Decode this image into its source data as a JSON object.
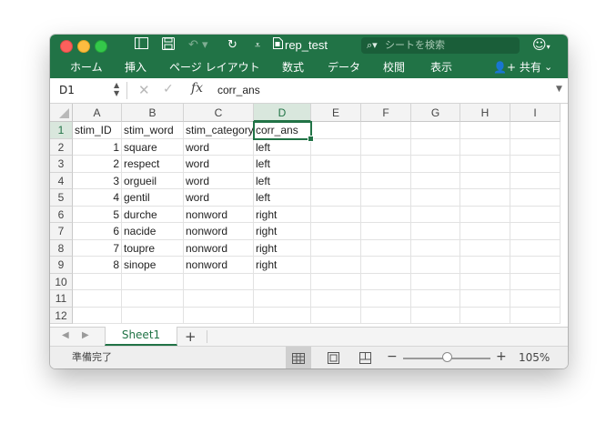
{
  "window": {
    "doc_title": "rep_test",
    "search_placeholder": "シートを検索",
    "toolbar_icons": [
      "sidebar-icon",
      "save-icon",
      "undo-icon",
      "redo-icon",
      "customize-icon"
    ]
  },
  "ribbon": {
    "tabs": [
      "ホーム",
      "挿入",
      "ページ レイアウト",
      "数式",
      "データ",
      "校閲",
      "表示"
    ],
    "share_label": "共有"
  },
  "formula_bar": {
    "name_box": "D1",
    "fx_label": "fx",
    "value": "corr_ans"
  },
  "grid": {
    "columns": [
      "A",
      "B",
      "C",
      "D",
      "E",
      "F",
      "G",
      "H",
      "I"
    ],
    "row_numbers": [
      "1",
      "2",
      "3",
      "4",
      "5",
      "6",
      "7",
      "8",
      "9",
      "10",
      "11",
      "12"
    ],
    "selected_cell": "D1",
    "rows": [
      [
        "stim_ID",
        "stim_word",
        "stim_category",
        "corr_ans"
      ],
      [
        "1",
        "square",
        "word",
        "left"
      ],
      [
        "2",
        "respect",
        "word",
        "left"
      ],
      [
        "3",
        "orgueil",
        "word",
        "left"
      ],
      [
        "4",
        "gentil",
        "word",
        "left"
      ],
      [
        "5",
        "durche",
        "nonword",
        "right"
      ],
      [
        "6",
        "nacide",
        "nonword",
        "right"
      ],
      [
        "7",
        "toupre",
        "nonword",
        "right"
      ],
      [
        "8",
        "sinope",
        "nonword",
        "right"
      ]
    ]
  },
  "sheets": {
    "tabs": [
      "Sheet1"
    ],
    "active": "Sheet1",
    "add_label": "+"
  },
  "status": {
    "text": "準備完了",
    "zoom": "105%",
    "zoom_fraction": 0.5
  },
  "colors": {
    "accent": "#217346",
    "selection_fill": "#d9e7dd"
  }
}
